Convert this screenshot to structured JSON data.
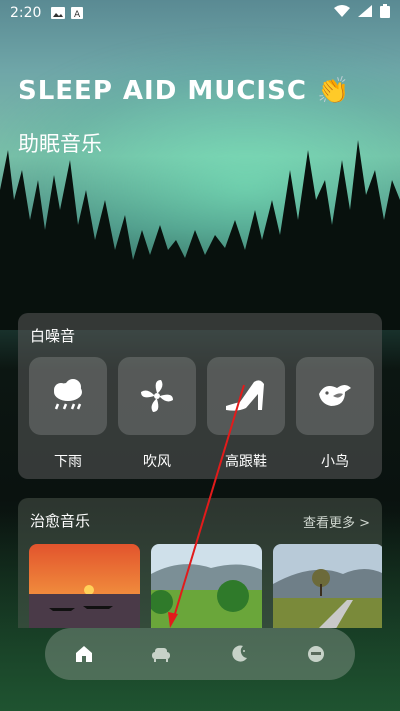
{
  "status": {
    "time": "2:20"
  },
  "header": {
    "title": "SLEEP AID MUCISC 👏",
    "subtitle": "助眠音乐"
  },
  "white_noise": {
    "title": "白噪音",
    "items": [
      {
        "label": "下雨",
        "icon": "rain-cloud-icon"
      },
      {
        "label": "吹风",
        "icon": "fan-icon"
      },
      {
        "label": "高跟鞋",
        "icon": "high-heel-icon"
      },
      {
        "label": "小鸟",
        "icon": "bird-icon"
      }
    ]
  },
  "healing_music": {
    "title": "治愈音乐",
    "more_label": "查看更多 >"
  },
  "nav": {
    "items": [
      "home-icon",
      "sofa-icon",
      "moon-icon",
      "face-icon"
    ]
  },
  "colors": {
    "accent_arrow": "#e21b1b"
  }
}
